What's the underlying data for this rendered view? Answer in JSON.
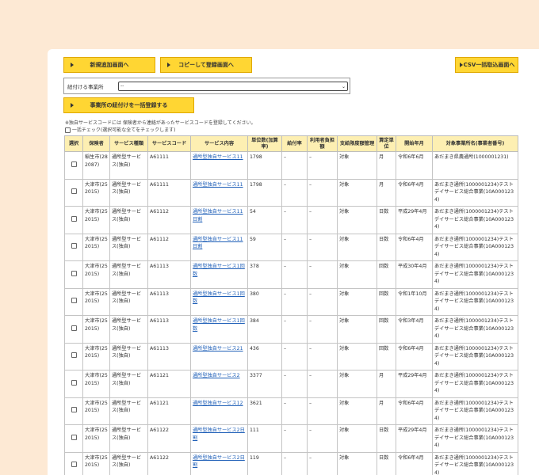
{
  "buttons": {
    "new": "新規追加画面へ",
    "copy": "コピーして登録画面へ",
    "csv": "CSV一括取込画面へ",
    "bulk": "事業所の紐付けを一括登録する"
  },
  "select": {
    "label": "紐付ける事業所",
    "value": "--"
  },
  "notes": {
    "line1": "※独自サービスコードには 保険者から連絡があったサービスコードを登録してください。",
    "line2": "一括チェック(選択可能な全てをチェックします)"
  },
  "table": {
    "headers": [
      "選択",
      "保険者",
      "サービス種類",
      "サービスコード",
      "サービス内容",
      "単位数(加算率)",
      "給付率",
      "利用者負担額",
      "支給限度額管理",
      "算定単位",
      "開始年月",
      "対象事業所名(事業者番号)"
    ],
    "rows": [
      [
        "稲生市(282087)",
        "通所型サービス(独自)",
        "A61111",
        "通所型独自サービス11",
        "1798",
        "–",
        "–",
        "対象",
        "月",
        "令和6年6月",
        "あだまき県農通所(1000001231)"
      ],
      [
        "大津市(252015)",
        "通所型サービス(独自)",
        "A61111",
        "通所型独自サービス11",
        "1798",
        "–",
        "–",
        "対象",
        "月",
        "令和6年4月",
        "あだまき通所(1000001234)テストデイサービス総合事業(10A0001234)"
      ],
      [
        "大津市(252015)",
        "通所型サービス(独自)",
        "A61112",
        "通所型独自サービス11日割",
        "54",
        "–",
        "–",
        "対象",
        "日数",
        "平成29年4月",
        "あだまき通所(1000001234)テストデイサービス総合事業(10A0001234)"
      ],
      [
        "大津市(252015)",
        "通所型サービス(独自)",
        "A61112",
        "通所型独自サービス11日割",
        "59",
        "–",
        "–",
        "対象",
        "日数",
        "令和6年4月",
        "あだまき通所(1000001234)テストデイサービス総合事業(10A0001234)"
      ],
      [
        "大津市(252015)",
        "通所型サービス(独自)",
        "A61113",
        "通所型独自サービス1回数",
        "378",
        "–",
        "–",
        "対象",
        "回数",
        "平成30年4月",
        "あだまき通所(1000001234)テストデイサービス総合事業(10A0001234)"
      ],
      [
        "大津市(252015)",
        "通所型サービス(独自)",
        "A61113",
        "通所型独自サービス1回数",
        "380",
        "–",
        "–",
        "対象",
        "回数",
        "令和1年10月",
        "あだまき通所(1000001234)テストデイサービス総合事業(10A0001234)"
      ],
      [
        "大津市(252015)",
        "通所型サービス(独自)",
        "A61113",
        "通所型独自サービス1回数",
        "384",
        "–",
        "–",
        "対象",
        "回数",
        "令和3年4月",
        "あだまき通所(1000001234)テストデイサービス総合事業(10A0001234)"
      ],
      [
        "大津市(252015)",
        "通所型サービス(独自)",
        "A61113",
        "通所型独自サービス21",
        "436",
        "–",
        "–",
        "対象",
        "回数",
        "令和6年4月",
        "あだまき通所(1000001234)テストデイサービス総合事業(10A0001234)"
      ],
      [
        "大津市(252015)",
        "通所型サービス(独自)",
        "A61121",
        "通所型独自サービス2",
        "3377",
        "–",
        "–",
        "対象",
        "月",
        "平成29年4月",
        "あだまき通所(1000001234)テストデイサービス総合事業(10A0001234)"
      ],
      [
        "大津市(252015)",
        "通所型サービス(独自)",
        "A61121",
        "通所型独自サービス12",
        "3621",
        "–",
        "–",
        "対象",
        "月",
        "令和6年4月",
        "あだまき通所(1000001234)テストデイサービス総合事業(10A0001234)"
      ],
      [
        "大津市(252015)",
        "通所型サービス(独自)",
        "A61122",
        "通所型独自サービス2日割",
        "111",
        "–",
        "–",
        "対象",
        "日数",
        "平成29年4月",
        "あだまき通所(1000001234)テストデイサービス総合事業(10A0001234)"
      ],
      [
        "大津市(252015)",
        "通所型サービス(独自)",
        "A61122",
        "通所型独自サービス2日割",
        "119",
        "–",
        "–",
        "対象",
        "日数",
        "令和6年4月",
        "あだまき通所(1000001234)テストデイサービス総合事業(10A0001234)"
      ]
    ]
  }
}
